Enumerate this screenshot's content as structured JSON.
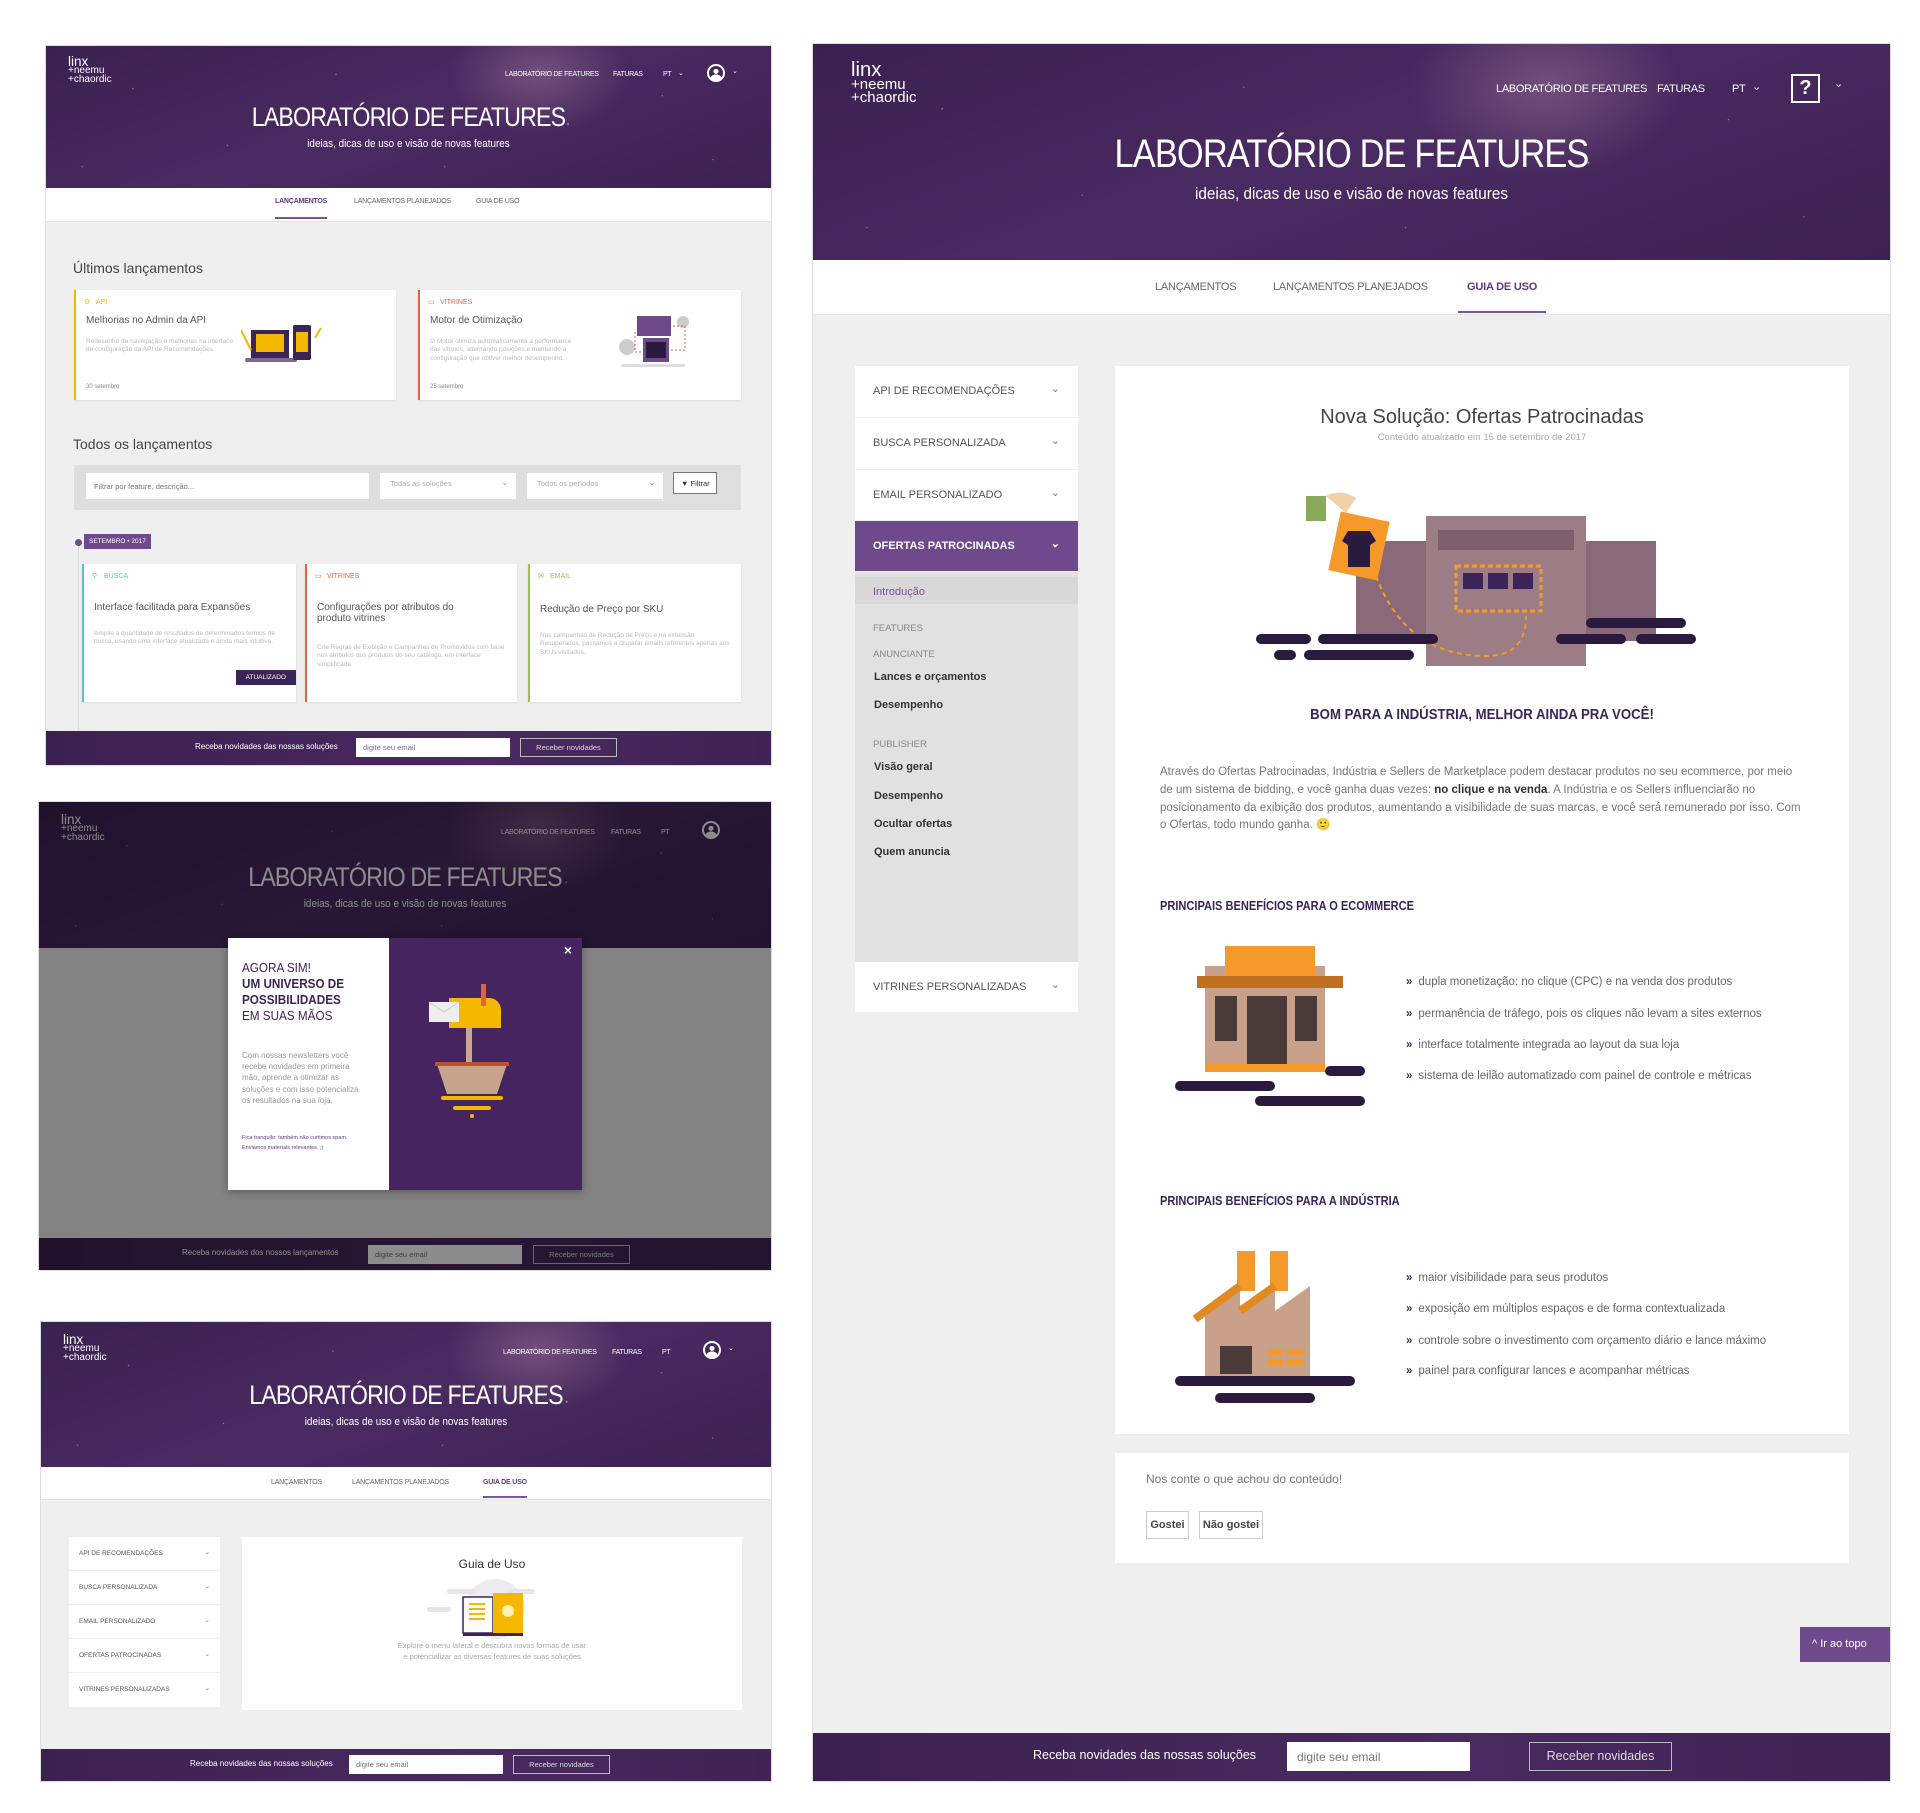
{
  "header": {
    "logo": {
      "line1": "linx",
      "line2": "+neemu",
      "line3": "+chaordic"
    },
    "nav": {
      "lab": "LABORATÓRIO DE FEATURES",
      "faturas": "FATURAS",
      "lang": "PT"
    },
    "title": "LABORATÓRIO DE FEATURES",
    "subtitle": "ideias, dicas de uso e visão de novas features"
  },
  "tabs": {
    "launches": "LANÇAMENTOS",
    "planned": "LANÇAMENTOS PLANEJADOS",
    "guide": "GUIA DE USO"
  },
  "launches": {
    "latest_heading": "Últimos lançamentos",
    "latest": [
      {
        "category": "API",
        "title": "Melhorias no Admin da API",
        "description": "Redesenho da navegação e melhorias na interface de configuração da API de Recomendações.",
        "date": "30 setembro",
        "color": "#f5b800"
      },
      {
        "category": "VITRINES",
        "title": "Motor de Otimização",
        "description": "O Motor otimiza automaticamente a performance das vitrines, alternando posições e mantendo a configuração que obtiver melhor desempenho.",
        "date": "25 setembro",
        "color": "#e8603c"
      }
    ],
    "all_heading": "Todos os lançamentos",
    "filter": {
      "placeholder": "Filtrar por feature, descrição...",
      "solutions": "Todas as soluções",
      "periods": "Todos os períodos",
      "button": "Filtrar"
    },
    "month_tag": "SETEMBRO • 2017",
    "items": [
      {
        "category": "BUSCA",
        "title": "Interface facilitada para Expansões",
        "description": "Amplie a quantidade de resultados de determinados termos de busca, usando uma interface atualizada e ainda mais intuitiva.",
        "badge": "ATUALIZADO",
        "color": "#5bc4c6"
      },
      {
        "category": "VITRINES",
        "title": "Configurações por atributos do produto vitrines",
        "description": "Crie Regras de Exibição e Campanhas de Promovidos com base nos atributos dos produtos do seu catálogo, em interface simplificada.",
        "color": "#e8603c"
      },
      {
        "category": "EMAIL",
        "title": "Redução de Preço por SKU",
        "description": "Nas campanhas de Redução de Preço e na extensão Recuperados, passamos a disparar emails referentes apenas aos SKUs visitados.",
        "color": "#9bc25a"
      }
    ]
  },
  "footer": {
    "text": "Receba novidades das nossas soluções",
    "text_alt": "Receba novidades dos nossos lançamentos",
    "placeholder": "digite seu email",
    "button": "Receber novidades"
  },
  "modal": {
    "line1": "AGORA SIM!",
    "line2": "UM UNIVERSO DE",
    "line3": "POSSIBILIDADES",
    "line4": "EM SUAS MÃOS",
    "body": "Com nossas newsletters você recebe novidades em primeira mão, aprende a otimizar as soluções e com isso potencializa os resultados na sua loja.",
    "note": "Fica tranquilo: também não curtimos spam. Enviamos materiais relevantes. ;)",
    "close": "×"
  },
  "guide": {
    "menu": [
      "API DE RECOMENDAÇÕES",
      "BUSCA PERSONALIZADA",
      "EMAIL PERSONALIZADO",
      "OFERTAS PATROCINADAS",
      "VITRINES PERSONALIZADAS"
    ],
    "title": "Guia de Uso",
    "text1": "Explore o menu lateral e descubra novas formas de usar",
    "text2": "e potencializar as diversas features de suas soluções"
  },
  "article": {
    "submenu": {
      "intro": "Introdução",
      "features": "FEATURES",
      "advertiser": "ANUNCIANTE",
      "adv_items": [
        "Lances e orçamentos",
        "Desempenho"
      ],
      "publisher": "PUBLISHER",
      "pub_items": [
        "Visão geral",
        "Desempenho",
        "Ocultar ofertas",
        "Quem anuncia"
      ]
    },
    "title": "Nova Solução: Ofertas Patrocinadas",
    "updated": "Conteúdo atualizado em 15 de setembro de 2017",
    "tagline": "BOM PARA A INDÚSTRIA, MELHOR AINDA PRA VOCÊ!",
    "para_1": "Através do Ofertas Patrocinadas, Indústria e Sellers de Marketplace podem destacar produtos no seu ecommerce, por meio de um sistema de bidding, e você ganha duas vezes: ",
    "para_bold": "no clique e na venda",
    "para_2": ". A Indústria e os Sellers influenciarão no posicionamento da exibição dos produtos, aumentando a visibilidade de suas marcas, e você será remunerado por isso. Com o Ofertas, todo mundo ganha. 🙂",
    "ecommerce_heading": "PRINCIPAIS BENEFÍCIOS PARA O ECOMMERCE",
    "ecommerce_benefits": [
      "dupla monetização: no clique (CPC) e na venda dos produtos",
      "permanência de tráfego, pois os cliques não levam a sites externos",
      "interface totalmente integrada ao layout da sua loja",
      "sistema de leilão automatizado com painel de controle e métricas"
    ],
    "industry_heading": "PRINCIPAIS BENEFÍCIOS PARA A INDÚSTRIA",
    "industry_benefits": [
      "maior visibilidade para seus produtos",
      "exposição em múltiplos espaços e de forma contextualizada",
      "controle sobre o investimento com orçamento diário e lance máximo",
      "painel para configurar lances e acompanhar métricas"
    ],
    "bullet": "»",
    "feedback": {
      "question": "Nos conte o que achou do conteúdo!",
      "like": "Gostei",
      "dislike": "Não gostei"
    },
    "back_to_top": "Ir ao topo",
    "help": "?"
  },
  "colors": {
    "brand": "#4a2a62",
    "accent": "#6e4a8c",
    "active_menu": "#6e4a8c",
    "heading": "#3b2558"
  }
}
